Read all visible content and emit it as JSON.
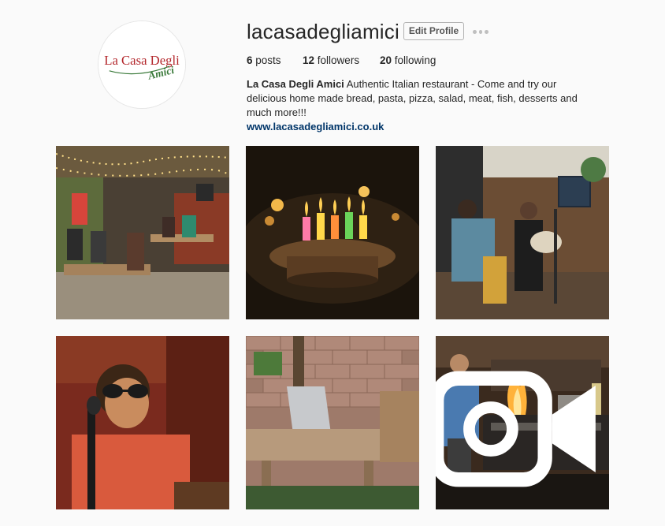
{
  "profile": {
    "username": "lacasadegliamici",
    "edit_label": "Edit Profile",
    "more_icon": "more-dots-icon",
    "avatar": {
      "line1": "La Casa Degli",
      "line2": "Amici",
      "colors": {
        "red": "#b3262b",
        "green": "#3a7a3a"
      }
    }
  },
  "stats": {
    "posts": {
      "count": "6",
      "label": "posts"
    },
    "followers": {
      "count": "12",
      "label": "followers"
    },
    "following": {
      "count": "20",
      "label": "following"
    }
  },
  "bio": {
    "name": "La Casa Degli Amici",
    "text": "Authentic Italian restaurant - Come and try our delicious home made bread, pasta, pizza, salad, meat, fish, desserts and much more!!!",
    "website": "www.lacasadegliamici.co.uk"
  },
  "posts": [
    {
      "scene": "outdoor patio with string lights and picnic tables"
    },
    {
      "scene": "birthday cake with lit candles"
    },
    {
      "scene": "live music duo with saxophone and guitar"
    },
    {
      "scene": "singer with sunglasses at microphone"
    },
    {
      "scene": "laptop on wooden garden table"
    },
    {
      "scene": "chef flambeing in kitchen",
      "video_icon": "video-camera-icon"
    }
  ],
  "colors": {
    "background": "#fafafa",
    "text": "#262626",
    "link": "#003569",
    "button_border": "#b2b2b2"
  }
}
